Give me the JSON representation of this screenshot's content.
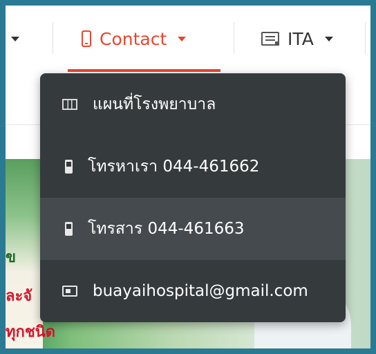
{
  "nav": {
    "contact_label": "Contact",
    "ita_label": "ITA"
  },
  "dropdown": {
    "items": [
      {
        "label": "แผนที่โรงพยาบาล",
        "icon": "map-icon"
      },
      {
        "label": "โทรหาเรา 044-461662",
        "icon": "mobile-phone-icon"
      },
      {
        "label": "โทรสาร 044-461663",
        "icon": "mobile-phone-icon"
      },
      {
        "label": "buayaihospital@gmail.com",
        "icon": "contact-card-icon"
      }
    ]
  },
  "banner": {
    "fragments": [
      "ข",
      "ละจั",
      "ทุกชนิด"
    ]
  },
  "colors": {
    "accent": "#e8472f",
    "dropdown_bg": "#353a3d",
    "dropdown_hover": "#444a4e",
    "frame_border": "#2b7a93"
  }
}
